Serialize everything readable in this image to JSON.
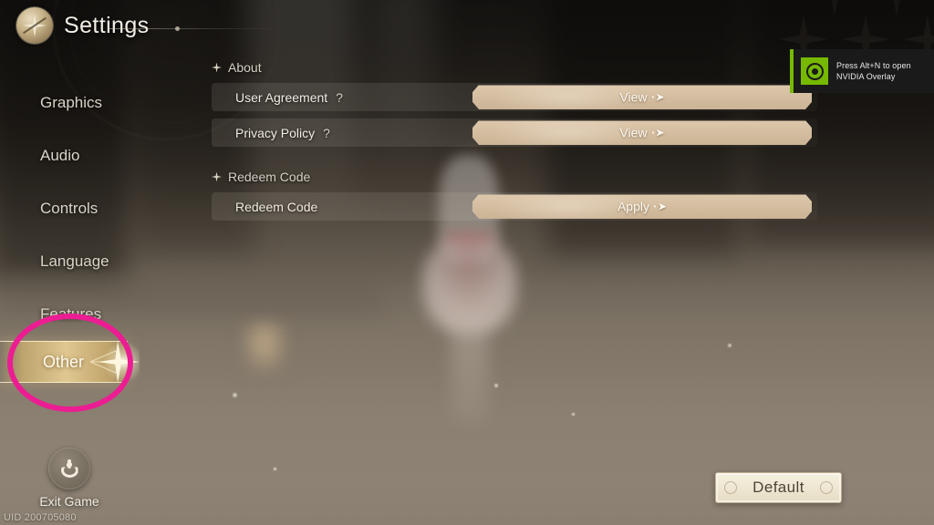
{
  "header": {
    "title": "Settings",
    "emblem_icon": "compass-emblem-icon"
  },
  "sidebar": {
    "items": [
      {
        "label": "Graphics",
        "selected": false
      },
      {
        "label": "Audio",
        "selected": false
      },
      {
        "label": "Controls",
        "selected": false
      },
      {
        "label": "Language",
        "selected": false
      },
      {
        "label": "Features",
        "selected": false
      },
      {
        "label": "Other",
        "selected": true
      }
    ],
    "selected_highlight_color": "#e8ce94",
    "annotation_circle_color": "#ec1d92"
  },
  "content": {
    "sections": [
      {
        "title": "About",
        "rows": [
          {
            "label": "User Agreement",
            "help": "?",
            "action": "View",
            "action_icon": "arrow-right-icon"
          },
          {
            "label": "Privacy Policy",
            "help": "?",
            "action": "View",
            "action_icon": "arrow-right-icon"
          }
        ]
      },
      {
        "title": "Redeem Code",
        "rows": [
          {
            "label": "Redeem Code",
            "help": "",
            "action": "Apply",
            "action_icon": "arrow-right-icon"
          }
        ]
      }
    ]
  },
  "footer": {
    "exit_label": "Exit Game",
    "exit_icon": "power-icon",
    "uid": "UID 200705080",
    "default_label": "Default"
  },
  "toast": {
    "logo_icon": "nvidia-eye-icon",
    "line1": "Press Alt+N to open",
    "line2": "NVIDIA Overlay",
    "accent_color": "#76b900"
  }
}
